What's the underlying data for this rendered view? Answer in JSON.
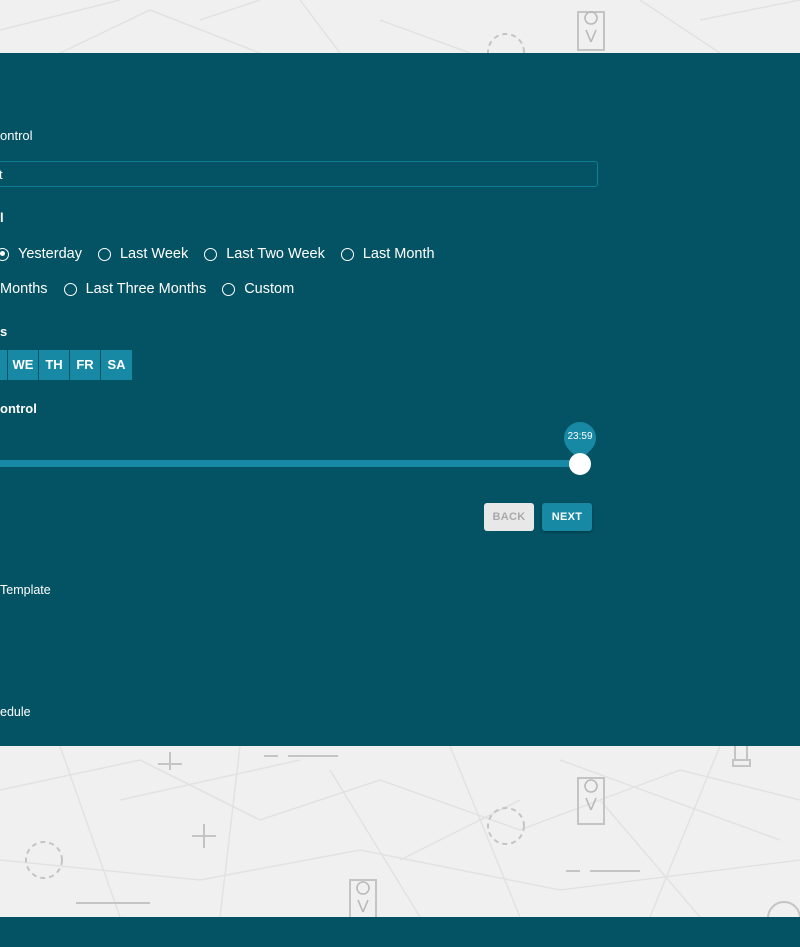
{
  "form": {
    "control_label_partial": "ontrol",
    "text_field_value_partial": "t",
    "period_label_partial": "l",
    "period_options_row1": [
      {
        "label": "Yesterday",
        "checked": true
      },
      {
        "label": "Last Week",
        "checked": false
      },
      {
        "label": "Last Two Week",
        "checked": false
      },
      {
        "label": "Last Month",
        "checked": false
      }
    ],
    "period_options_row2": [
      {
        "label": "Months",
        "checked": false
      },
      {
        "label": "Last Three Months",
        "checked": false
      },
      {
        "label": "Custom",
        "checked": false
      }
    ],
    "days_label_partial": "s",
    "days": [
      "WE",
      "TH",
      "FR",
      "SA"
    ],
    "time_label_partial": "ontrol",
    "slider_value": "23:59",
    "slider_fraction": 1.0,
    "back_label": "BACK",
    "next_label": "NEXT"
  },
  "steps": {
    "template_label_partial": "Template",
    "schedule_label_partial": "edule"
  },
  "colors": {
    "panel_bg": "#045365",
    "accent": "#1889a5",
    "page_bg": "#f0f0f0"
  }
}
